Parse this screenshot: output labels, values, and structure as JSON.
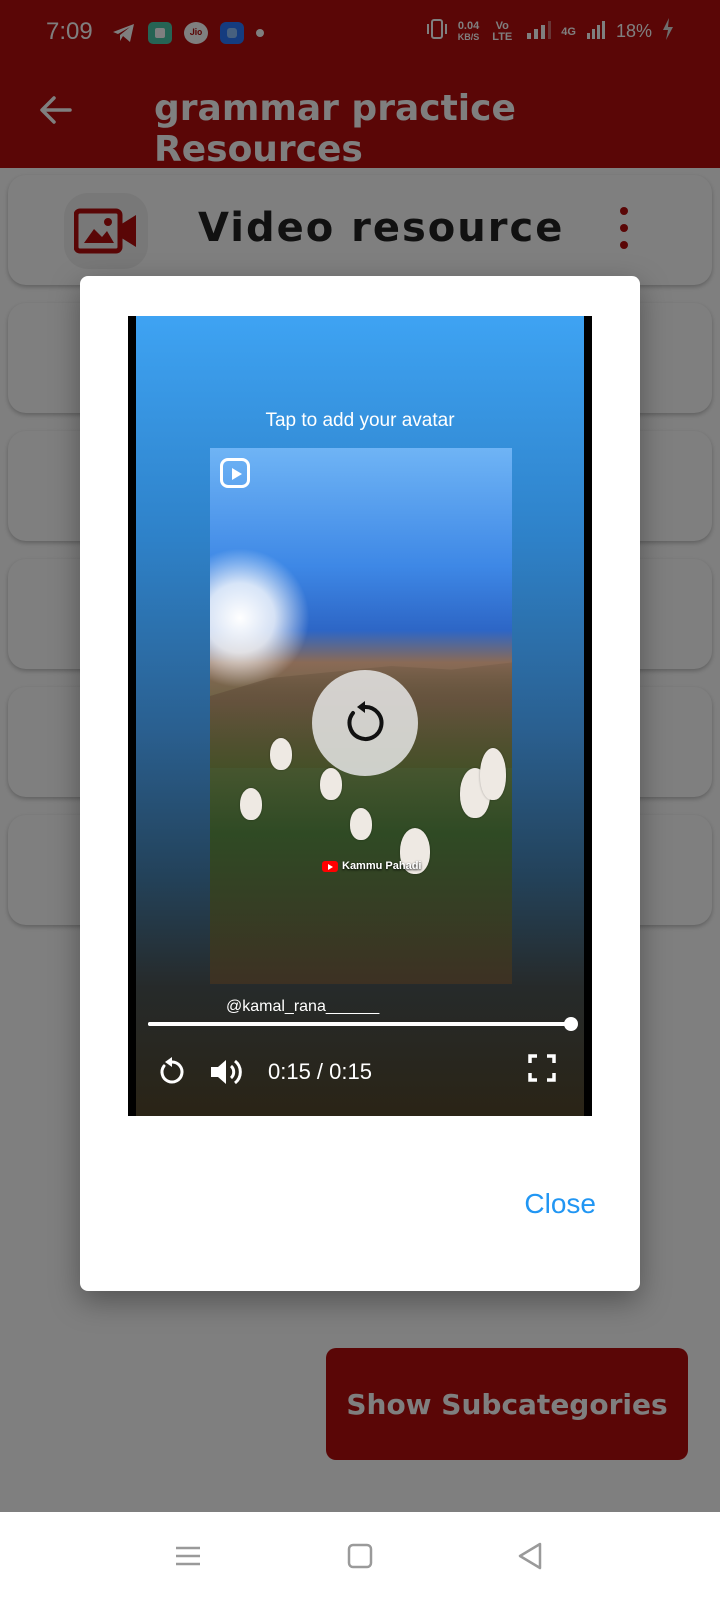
{
  "status_bar": {
    "time": "7:09",
    "net_speed": "0.04",
    "net_unit": "KB/S",
    "volte": "Vo LTE",
    "network": "4G",
    "battery": "18%"
  },
  "app_bar": {
    "title": "grammar practice Resources"
  },
  "cards": [
    {
      "title": "Video resource"
    }
  ],
  "dialog": {
    "video": {
      "overlay_text": "Tap to add your avatar",
      "credit": "Kammu Pahadi",
      "handle": "@kamal_rana______",
      "time": "0:15 / 0:15",
      "progress": 1.0
    },
    "close_label": "Close"
  },
  "bottom_button": {
    "label": "Show Subcategories"
  },
  "colors": {
    "primary": "#b50d0d",
    "accent": "#2196f3"
  }
}
